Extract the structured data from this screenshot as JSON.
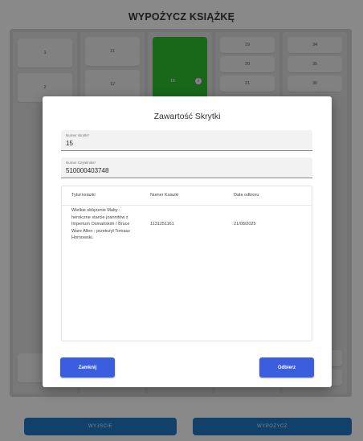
{
  "page": {
    "title": "WYPOŻYCZ KSIĄŻKĘ"
  },
  "grid": {
    "col1": [
      "1",
      "2"
    ],
    "col2": [
      "11",
      "12"
    ],
    "col3": [
      "15"
    ],
    "col4": [
      "19",
      "20",
      "21"
    ],
    "col5": [
      "34",
      "35",
      "36"
    ],
    "info_icon_glyph": "i",
    "selected_color": "#2bb22b"
  },
  "footer": {
    "exit_label": "WYJSCIE",
    "borrow_label": "WYPOZYCZ"
  },
  "modal": {
    "title": "Zawartość Skrytki",
    "locker_field": {
      "label": "Numer skrytki*",
      "value": "15"
    },
    "reader_field": {
      "label": "Numer Czytelnika*",
      "value": "510000403748"
    },
    "table": {
      "headers": [
        "Tytuł ksiazki",
        "Numer Ksiazki",
        "Data odbioru"
      ],
      "rows": [
        {
          "title_lines": [
            "Wielkie oblężenie Malty :",
            "heroiczne starcie joannitów z",
            "Imperium Osmańskim / Bruce",
            "Ware Allen ; przełożył Tomasz",
            "Hornowski."
          ],
          "number": "1131251161",
          "date": "21/08/2025"
        }
      ]
    },
    "close_label": "Zamknij",
    "pickup_label": "Odbierz",
    "accent_color": "#3b5ee0"
  }
}
